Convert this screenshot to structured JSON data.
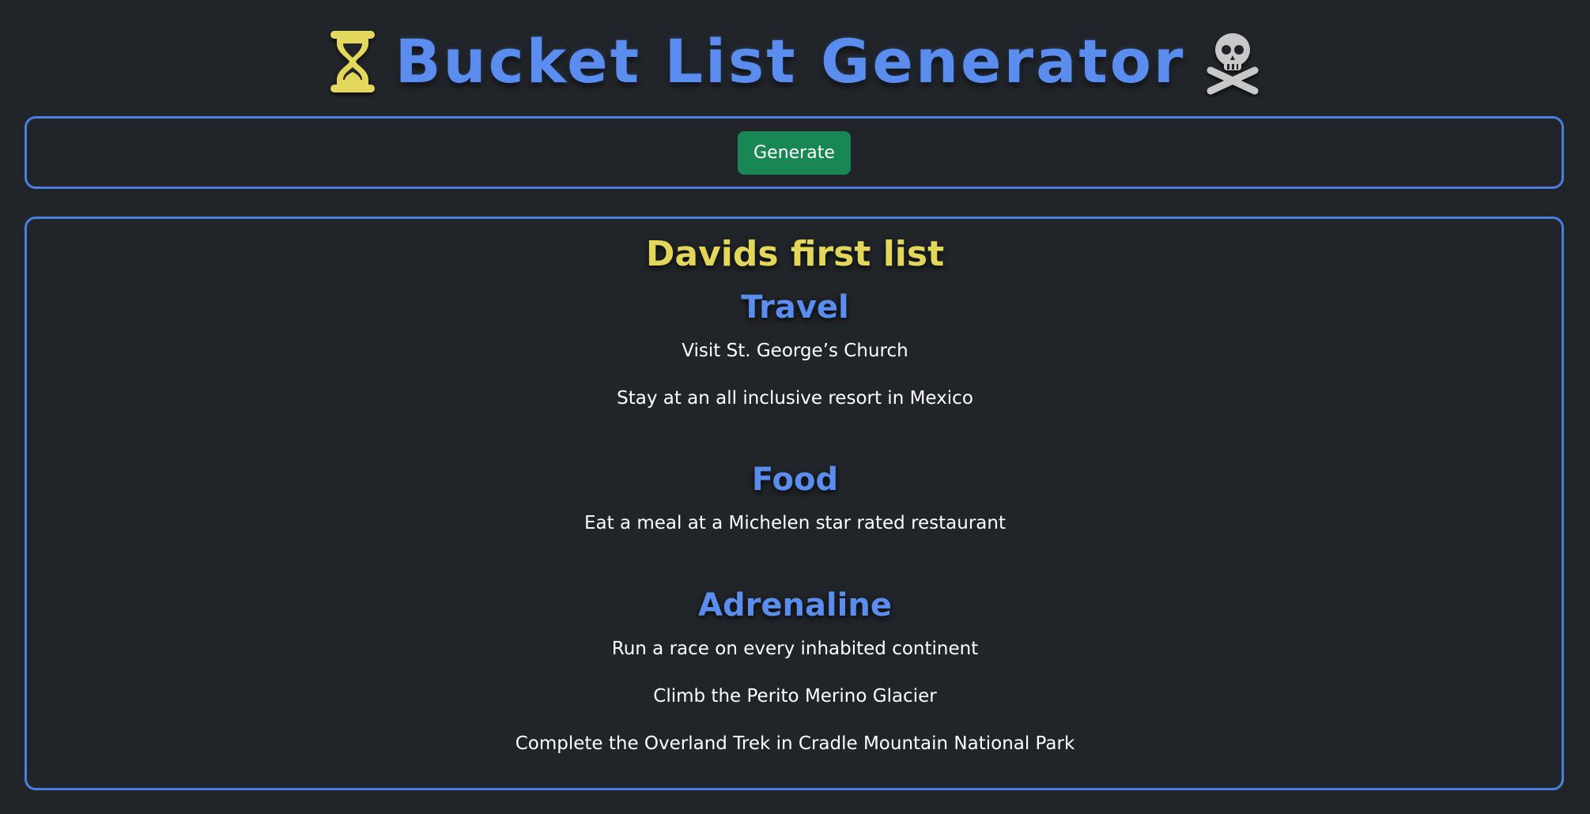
{
  "header": {
    "title": "Bucket List Generator",
    "left_icon": "hourglass-icon",
    "right_icon": "skull-crossbones-icon"
  },
  "controls": {
    "generate_label": "Generate"
  },
  "list": {
    "title": "Davids first list",
    "categories": [
      {
        "name": "Travel",
        "items": [
          "Visit St. George’s Church",
          "Stay at an all inclusive resort in Mexico"
        ]
      },
      {
        "name": "Food",
        "items": [
          "Eat a meal at a Michelen star rated restaurant"
        ]
      },
      {
        "name": "Adrenaline",
        "items": [
          "Run a race on every inhabited continent",
          "Climb the Perito Merino Glacier",
          "Complete the Overland Trek in Cradle Mountain National Park"
        ]
      }
    ]
  },
  "colors": {
    "background": "#212529",
    "accent_blue": "#5b8def",
    "panel_border": "#4a7fe0",
    "list_title_yellow": "#e3d75b",
    "button_green": "#198754"
  }
}
